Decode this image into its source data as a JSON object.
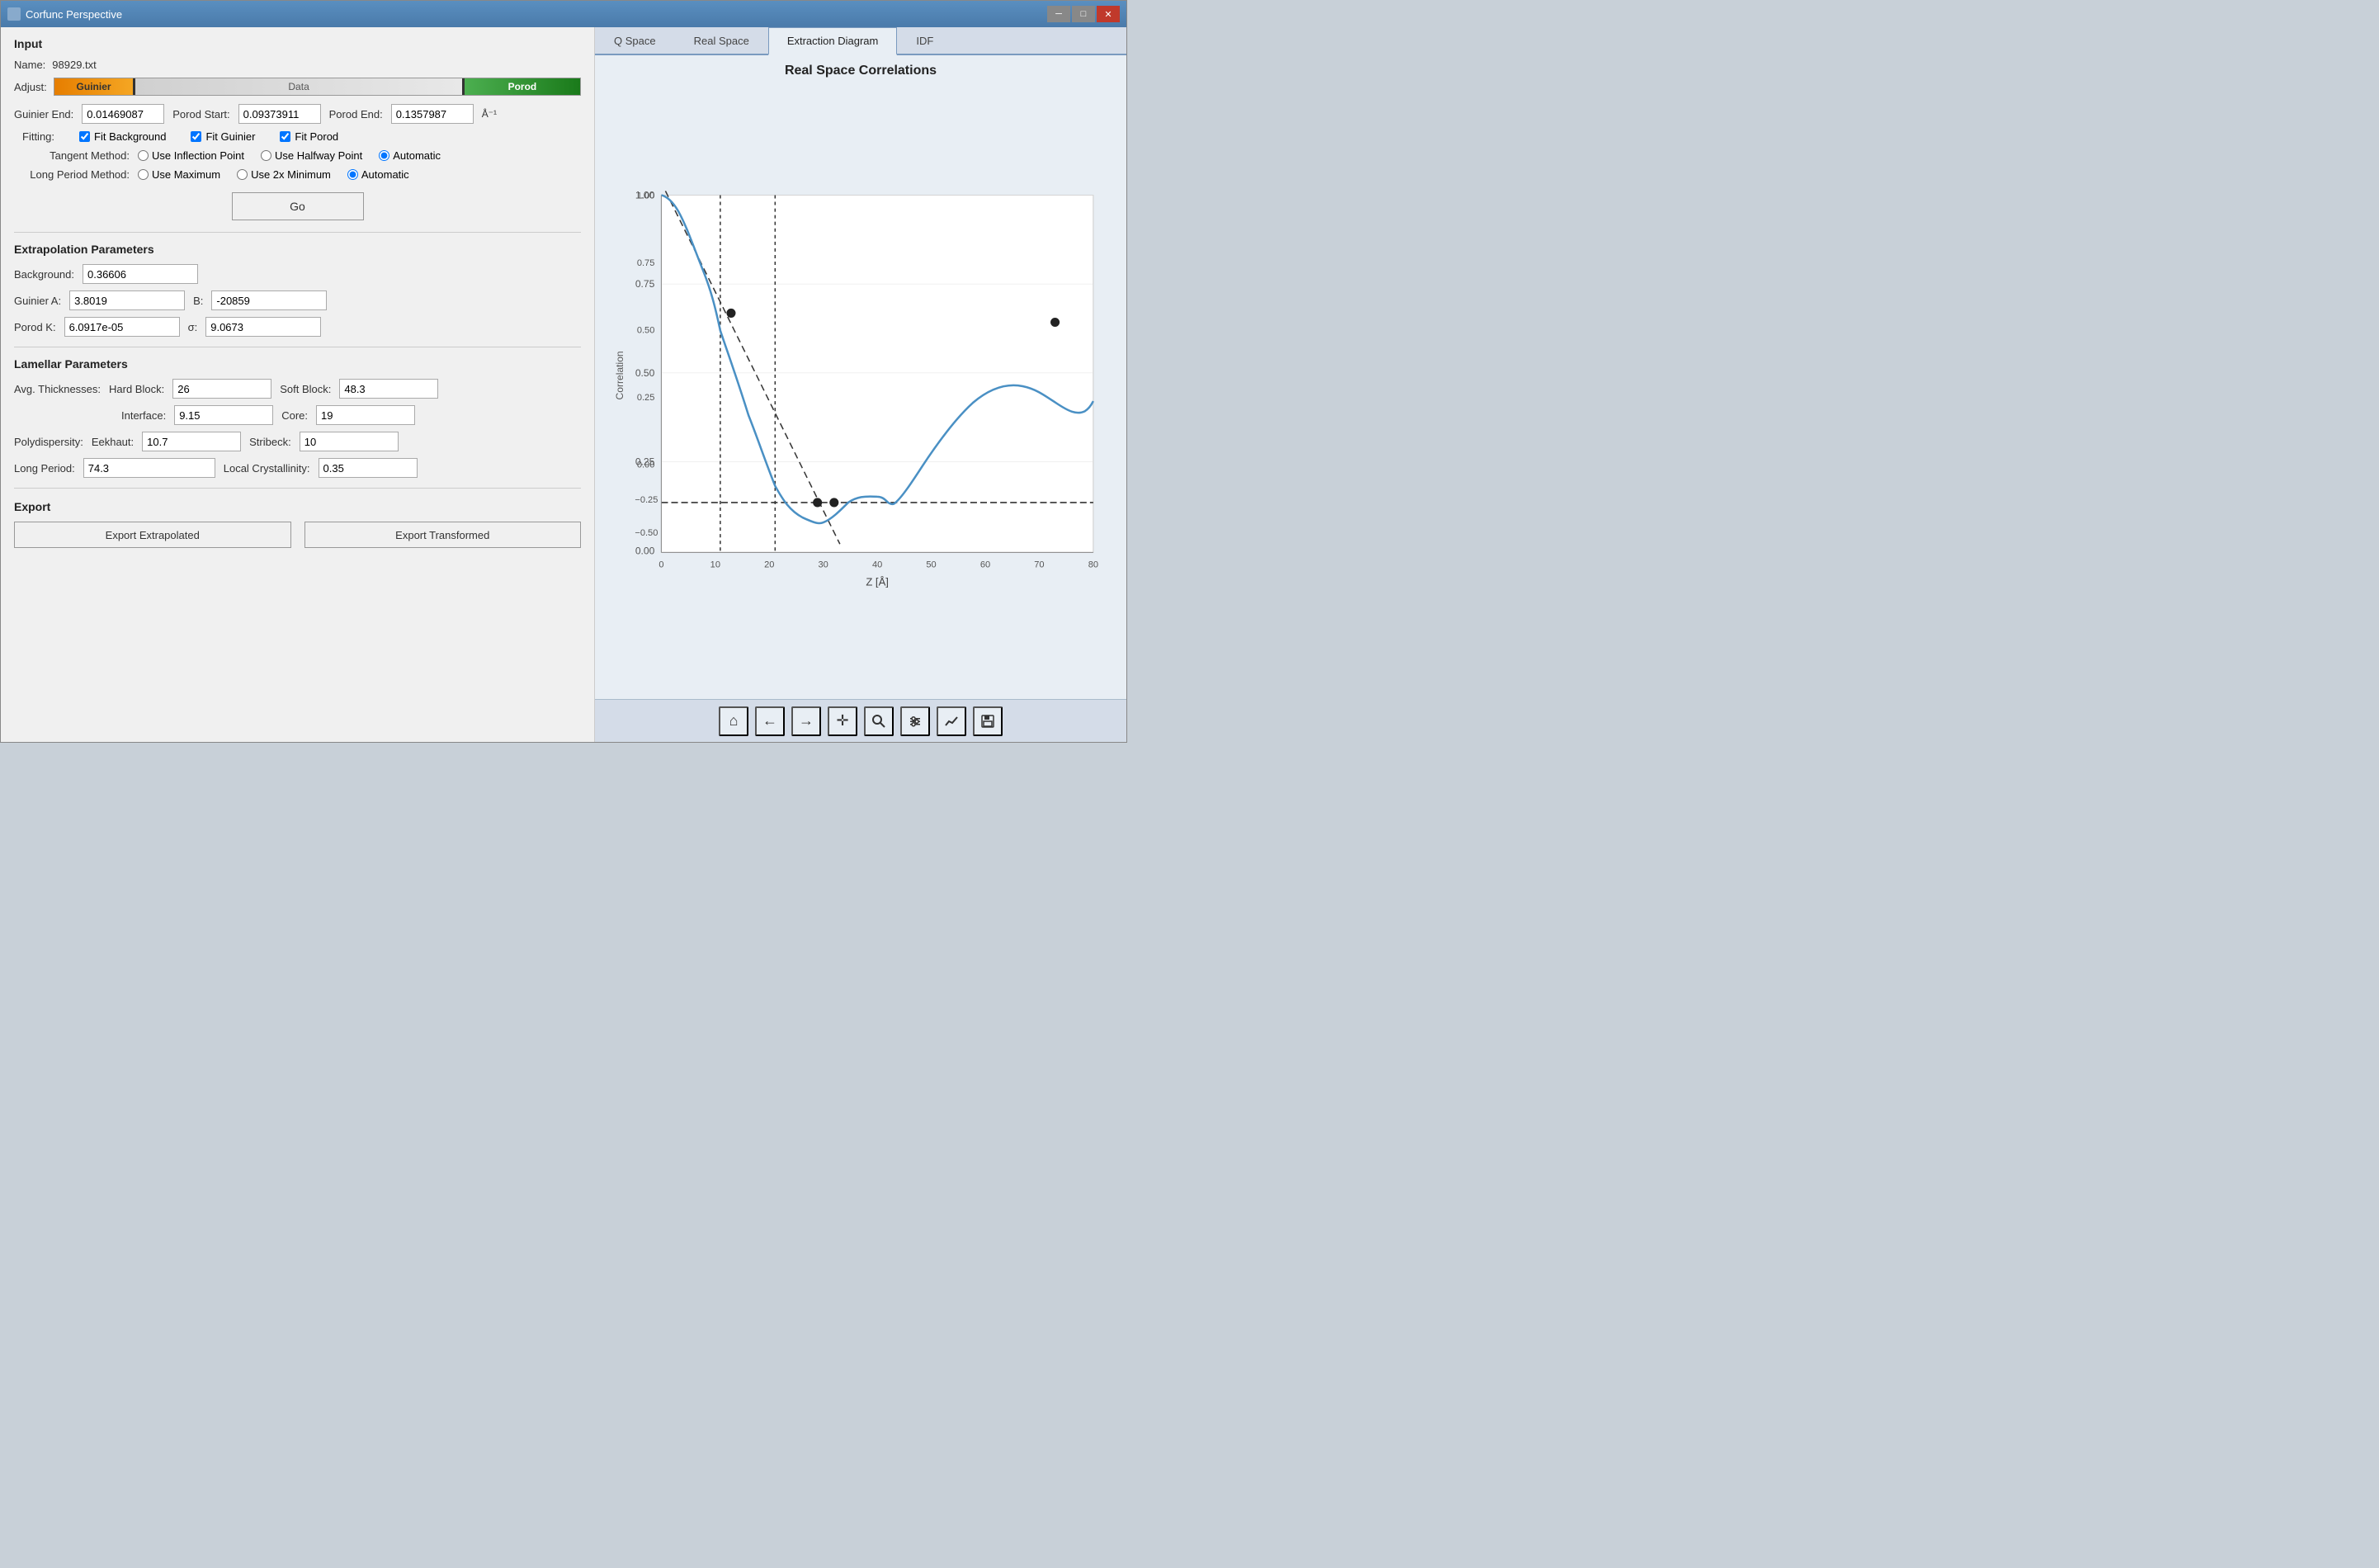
{
  "window": {
    "title": "Corfunc Perspective",
    "min_btn": "─",
    "max_btn": "□",
    "close_btn": "✕"
  },
  "left": {
    "input_section": "Input",
    "name_label": "Name:",
    "name_value": "98929.txt",
    "adjust_label": "Adjust:",
    "guinier_label": "Guinier",
    "data_label": "Data",
    "porod_label": "Porod",
    "guinier_end_label": "Guinier End:",
    "guinier_end_value": "0.01469087",
    "porod_start_label": "Porod Start:",
    "porod_start_value": "0.09373911",
    "porod_end_label": "Porod End:",
    "porod_end_value": "0.1357987",
    "unit_label": "Å⁻¹",
    "fitting_label": "Fitting:",
    "fit_background": "Fit Background",
    "fit_guinier": "Fit Guinier",
    "fit_porod": "Fit Porod",
    "tangent_method_label": "Tangent Method:",
    "use_inflection": "Use Inflection Point",
    "use_halfway": "Use Halfway Point",
    "automatic": "Automatic",
    "long_period_label": "Long Period Method:",
    "use_maximum": "Use Maximum",
    "use_2x_minimum": "Use 2x Minimum",
    "automatic2": "Automatic",
    "go_btn": "Go",
    "ext_params_title": "Extrapolation Parameters",
    "background_label": "Background:",
    "background_value": "0.36606",
    "guinier_a_label": "Guinier A:",
    "guinier_a_value": "3.8019",
    "b_label": "B:",
    "b_value": "-20859",
    "porod_k_label": "Porod K:",
    "porod_k_value": "6.0917e-05",
    "sigma_label": "σ:",
    "sigma_value": "9.0673",
    "lamellar_title": "Lamellar Parameters",
    "avg_thick_label": "Avg. Thicknesses:",
    "hard_block_label": "Hard Block:",
    "hard_block_value": "26",
    "soft_block_label": "Soft Block:",
    "soft_block_value": "48.3",
    "interface_label": "Interface:",
    "interface_value": "9.15",
    "core_label": "Core:",
    "core_value": "19",
    "polydispersity_label": "Polydispersity:",
    "eekhaut_label": "Eekhaut:",
    "eekhaut_value": "10.7",
    "stribeck_label": "Stribeck:",
    "stribeck_value": "10",
    "long_period_label2": "Long Period:",
    "long_period_value": "74.3",
    "local_crystal_label": "Local Crystallinity:",
    "local_crystal_value": "0.35",
    "export_title": "Export",
    "export_extrapolated": "Export Extrapolated",
    "export_transformed": "Export Transformed"
  },
  "right": {
    "tabs": [
      "Q Space",
      "Real Space",
      "Extraction Diagram",
      "IDF"
    ],
    "active_tab": "Extraction Diagram",
    "chart_title": "Real Space Correlations",
    "x_axis_label": "Z [Å]",
    "y_axis_label": "Correlation",
    "toolbar": {
      "home": "⌂",
      "back": "←",
      "forward": "→",
      "pan": "✛",
      "zoom": "🔍",
      "settings": "⚙",
      "line": "↗",
      "save": "💾"
    }
  }
}
